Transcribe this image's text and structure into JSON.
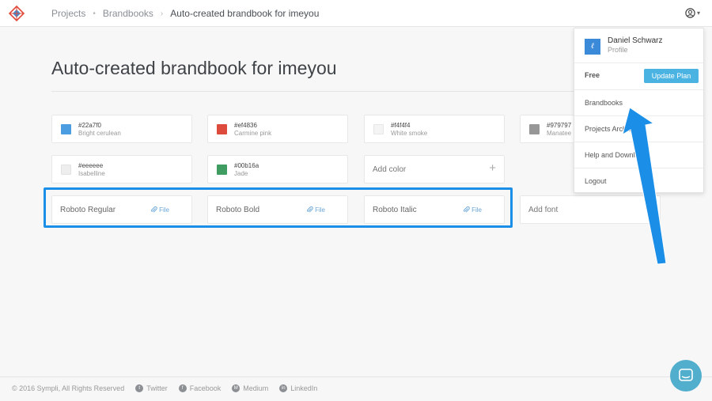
{
  "breadcrumb": {
    "items": [
      "Projects",
      "Brandbooks"
    ],
    "separators": [
      "•",
      "›"
    ],
    "current": "Auto-created brandbook for imeyou"
  },
  "user_menu": {
    "chevron": "▾",
    "icon": "user-circle-icon"
  },
  "page_title": "Auto-created brandbook for imeyou",
  "colors": [
    {
      "hex": "#22a7f0",
      "name": "Bright cerulean",
      "swatch": "#4a9de0"
    },
    {
      "hex": "#ef4836",
      "name": "Carmine pink",
      "swatch": "#dc4b3c"
    },
    {
      "hex": "#f4f4f4",
      "name": "White smoke",
      "swatch": "#f4f4f4"
    },
    {
      "hex": "#979797",
      "name": "Manatee",
      "swatch": "#979797"
    },
    {
      "hex": "#eeeeee",
      "name": "Isabelline",
      "swatch": "#eeeeee"
    },
    {
      "hex": "#00b16a",
      "name": "Jade",
      "swatch": "#3f9d62"
    }
  ],
  "add_color_label": "Add color",
  "plus_glyph": "+",
  "fonts": [
    {
      "name": "Roboto Regular",
      "file_label": "File"
    },
    {
      "name": "Roboto Bold",
      "file_label": "File"
    },
    {
      "name": "Roboto Italic",
      "file_label": "File"
    }
  ],
  "add_font_label": "Add font",
  "dropdown": {
    "user_name": "Daniel Schwarz",
    "profile_label": "Profile",
    "plan": "Free",
    "update_plan_label": "Update Plan",
    "items": [
      "Brandbooks",
      "Projects Archive",
      "Help and Downloads",
      "Logout"
    ]
  },
  "footer": {
    "copyright": "© 2016 Sympli, All Rights Reserved",
    "social": [
      {
        "label": "Twitter",
        "glyph": "t",
        "icon": "twitter-icon"
      },
      {
        "label": "Facebook",
        "glyph": "f",
        "icon": "facebook-icon"
      },
      {
        "label": "Medium",
        "glyph": "M",
        "icon": "medium-icon"
      },
      {
        "label": "LinkedIn",
        "glyph": "in",
        "icon": "linkedin-icon"
      }
    ]
  },
  "accent": {
    "highlight": "#1b8fe8",
    "button": "#4ab3e2",
    "link": "#6aa6d8",
    "chat": "#52aecd"
  }
}
